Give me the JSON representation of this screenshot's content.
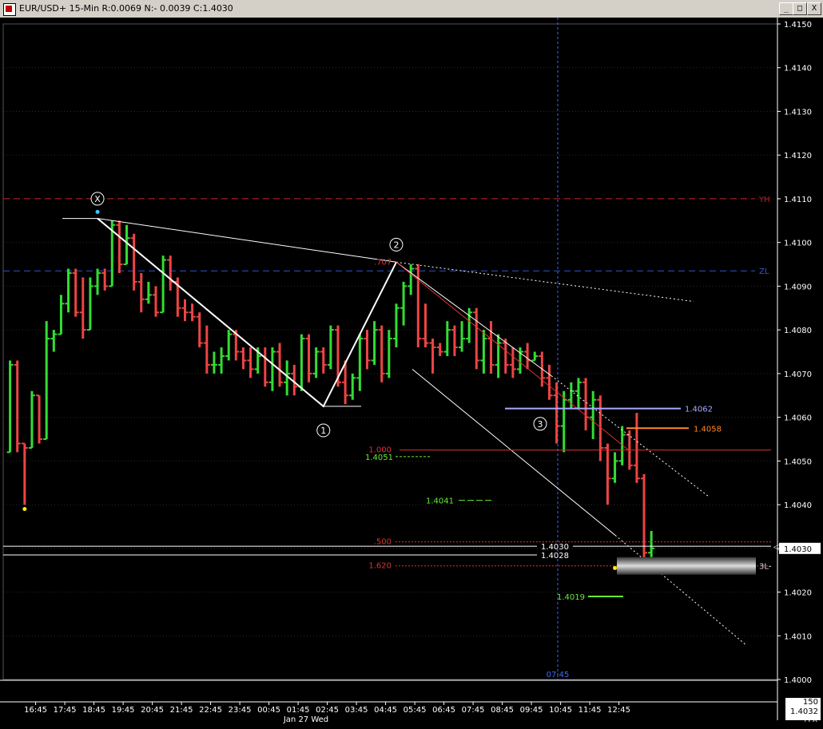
{
  "window": {
    "title": "EUR/USD+ 15-Min R:0.0069 N:- 0.0039 C:1.4030",
    "min_label": "_",
    "max_label": "□",
    "close_label": "X"
  },
  "colors": {
    "background": "#000000",
    "up_bar": "#33dd33",
    "down_bar": "#ee4444",
    "white_line": "#ffffff",
    "yh_line": "#cc2222",
    "zl_line": "#3355cc",
    "crosshair": "#4466ff",
    "fib_red": "#dd3333",
    "label_orange": "#ff8822",
    "label_lavender": "#aaaaff",
    "label_green": "#66ee33",
    "dot_yellow": "#ffee00",
    "dot_cyan": "#33ccff"
  },
  "chart_data": {
    "type": "candlestick-ohlc",
    "symbol": "EUR/USD+",
    "interval": "15-Min",
    "ylim": [
      1.4,
      1.415
    ],
    "y_ticks": [
      "1.4150",
      "1.4140",
      "1.4130",
      "1.4120",
      "1.4110",
      "1.4100",
      "1.4090",
      "1.4080",
      "1.4070",
      "1.4060",
      "1.4050",
      "1.4040",
      "1.4030",
      "1.4020",
      "1.4010",
      "1.4000"
    ],
    "x_ticks": [
      "16:45",
      "17:45",
      "18:45",
      "19:45",
      "20:45",
      "21:45",
      "22:45",
      "23:45",
      "00:45",
      "01:45",
      "02:45",
      "03:45",
      "04:45",
      "05:45",
      "06:45",
      "07:45",
      "08:45",
      "09:45",
      "10:45",
      "11:45",
      "12:45"
    ],
    "date_label": "Jan 27 Wed",
    "crosshair_time": "07:45",
    "bars": [
      {
        "o": 1.4052,
        "h": 1.4073,
        "l": 1.4052,
        "c": 1.4072
      },
      {
        "o": 1.4072,
        "h": 1.4073,
        "l": 1.4052,
        "c": 1.4054
      },
      {
        "o": 1.4054,
        "h": 1.4054,
        "l": 1.404,
        "c": 1.4053
      },
      {
        "o": 1.4053,
        "h": 1.4066,
        "l": 1.4053,
        "c": 1.4065
      },
      {
        "o": 1.4065,
        "h": 1.4065,
        "l": 1.4054,
        "c": 1.4055
      },
      {
        "o": 1.4055,
        "h": 1.4082,
        "l": 1.4055,
        "c": 1.4078
      },
      {
        "o": 1.4078,
        "h": 1.408,
        "l": 1.4075,
        "c": 1.4079
      },
      {
        "o": 1.4079,
        "h": 1.4088,
        "l": 1.4079,
        "c": 1.4086
      },
      {
        "o": 1.4086,
        "h": 1.4094,
        "l": 1.4084,
        "c": 1.4093
      },
      {
        "o": 1.4093,
        "h": 1.4094,
        "l": 1.4083,
        "c": 1.4084
      },
      {
        "o": 1.4084,
        "h": 1.4092,
        "l": 1.4078,
        "c": 1.408
      },
      {
        "o": 1.408,
        "h": 1.4092,
        "l": 1.408,
        "c": 1.409
      },
      {
        "o": 1.409,
        "h": 1.4094,
        "l": 1.4088,
        "c": 1.4093
      },
      {
        "o": 1.4093,
        "h": 1.4094,
        "l": 1.4089,
        "c": 1.409
      },
      {
        "o": 1.409,
        "h": 1.4105,
        "l": 1.409,
        "c": 1.4104
      },
      {
        "o": 1.4104,
        "h": 1.4105,
        "l": 1.4093,
        "c": 1.4095
      },
      {
        "o": 1.4095,
        "h": 1.4104,
        "l": 1.4095,
        "c": 1.4101
      },
      {
        "o": 1.4101,
        "h": 1.4102,
        "l": 1.4089,
        "c": 1.4091
      },
      {
        "o": 1.4091,
        "h": 1.4093,
        "l": 1.4084,
        "c": 1.4087
      },
      {
        "o": 1.4087,
        "h": 1.4091,
        "l": 1.4086,
        "c": 1.4088
      },
      {
        "o": 1.4088,
        "h": 1.409,
        "l": 1.4083,
        "c": 1.4084
      },
      {
        "o": 1.4084,
        "h": 1.4097,
        "l": 1.4084,
        "c": 1.4096
      },
      {
        "o": 1.4096,
        "h": 1.4097,
        "l": 1.4089,
        "c": 1.4091
      },
      {
        "o": 1.4091,
        "h": 1.4092,
        "l": 1.4083,
        "c": 1.4085
      },
      {
        "o": 1.4085,
        "h": 1.4087,
        "l": 1.4082,
        "c": 1.4084
      },
      {
        "o": 1.4084,
        "h": 1.4086,
        "l": 1.4082,
        "c": 1.4083
      },
      {
        "o": 1.4083,
        "h": 1.4084,
        "l": 1.4076,
        "c": 1.4077
      },
      {
        "o": 1.4077,
        "h": 1.4081,
        "l": 1.407,
        "c": 1.4072
      },
      {
        "o": 1.4072,
        "h": 1.4075,
        "l": 1.407,
        "c": 1.4072
      },
      {
        "o": 1.4072,
        "h": 1.4076,
        "l": 1.407,
        "c": 1.4074
      },
      {
        "o": 1.4074,
        "h": 1.408,
        "l": 1.4073,
        "c": 1.4079
      },
      {
        "o": 1.4079,
        "h": 1.408,
        "l": 1.4073,
        "c": 1.4075
      },
      {
        "o": 1.4075,
        "h": 1.4076,
        "l": 1.4071,
        "c": 1.4073
      },
      {
        "o": 1.4073,
        "h": 1.4076,
        "l": 1.4069,
        "c": 1.4071
      },
      {
        "o": 1.4071,
        "h": 1.4076,
        "l": 1.407,
        "c": 1.4074
      },
      {
        "o": 1.4074,
        "h": 1.4076,
        "l": 1.4067,
        "c": 1.4068
      },
      {
        "o": 1.4068,
        "h": 1.4076,
        "l": 1.4066,
        "c": 1.4075
      },
      {
        "o": 1.4075,
        "h": 1.4077,
        "l": 1.4067,
        "c": 1.4068
      },
      {
        "o": 1.4068,
        "h": 1.4073,
        "l": 1.4065,
        "c": 1.407
      },
      {
        "o": 1.407,
        "h": 1.4072,
        "l": 1.4065,
        "c": 1.4067
      },
      {
        "o": 1.4067,
        "h": 1.4079,
        "l": 1.4066,
        "c": 1.4078
      },
      {
        "o": 1.4078,
        "h": 1.4079,
        "l": 1.4068,
        "c": 1.407
      },
      {
        "o": 1.407,
        "h": 1.4076,
        "l": 1.4069,
        "c": 1.4075
      },
      {
        "o": 1.4075,
        "h": 1.4076,
        "l": 1.407,
        "c": 1.4072
      },
      {
        "o": 1.4072,
        "h": 1.4081,
        "l": 1.4071,
        "c": 1.408
      },
      {
        "o": 1.408,
        "h": 1.4081,
        "l": 1.4067,
        "c": 1.4068
      },
      {
        "o": 1.4068,
        "h": 1.4073,
        "l": 1.4063,
        "c": 1.4065
      },
      {
        "o": 1.4065,
        "h": 1.407,
        "l": 1.4064,
        "c": 1.4069
      },
      {
        "o": 1.4069,
        "h": 1.4079,
        "l": 1.4066,
        "c": 1.4078
      },
      {
        "o": 1.4078,
        "h": 1.408,
        "l": 1.4071,
        "c": 1.4073
      },
      {
        "o": 1.4073,
        "h": 1.4082,
        "l": 1.4072,
        "c": 1.408
      },
      {
        "o": 1.408,
        "h": 1.4081,
        "l": 1.4068,
        "c": 1.407
      },
      {
        "o": 1.407,
        "h": 1.408,
        "l": 1.4069,
        "c": 1.4078
      },
      {
        "o": 1.4078,
        "h": 1.4086,
        "l": 1.4076,
        "c": 1.4085
      },
      {
        "o": 1.4085,
        "h": 1.4091,
        "l": 1.4081,
        "c": 1.409
      },
      {
        "o": 1.409,
        "h": 1.4095,
        "l": 1.4088,
        "c": 1.4094
      },
      {
        "o": 1.4094,
        "h": 1.4095,
        "l": 1.4076,
        "c": 1.4078
      },
      {
        "o": 1.4078,
        "h": 1.4086,
        "l": 1.4076,
        "c": 1.4077
      },
      {
        "o": 1.4077,
        "h": 1.4078,
        "l": 1.407,
        "c": 1.4076
      },
      {
        "o": 1.4076,
        "h": 1.4077,
        "l": 1.4074,
        "c": 1.4075
      },
      {
        "o": 1.4075,
        "h": 1.4082,
        "l": 1.4074,
        "c": 1.408
      },
      {
        "o": 1.408,
        "h": 1.4081,
        "l": 1.4074,
        "c": 1.4076
      },
      {
        "o": 1.4076,
        "h": 1.4082,
        "l": 1.4075,
        "c": 1.4078
      },
      {
        "o": 1.4078,
        "h": 1.4085,
        "l": 1.4077,
        "c": 1.4084
      },
      {
        "o": 1.4084,
        "h": 1.4085,
        "l": 1.4071,
        "c": 1.4073
      },
      {
        "o": 1.4073,
        "h": 1.408,
        "l": 1.407,
        "c": 1.4078
      },
      {
        "o": 1.4078,
        "h": 1.4082,
        "l": 1.407,
        "c": 1.4072
      },
      {
        "o": 1.4072,
        "h": 1.4079,
        "l": 1.4069,
        "c": 1.4077
      },
      {
        "o": 1.4077,
        "h": 1.4078,
        "l": 1.407,
        "c": 1.4072
      },
      {
        "o": 1.4072,
        "h": 1.4076,
        "l": 1.4069,
        "c": 1.4071
      },
      {
        "o": 1.4071,
        "h": 1.4076,
        "l": 1.407,
        "c": 1.4075
      },
      {
        "o": 1.4075,
        "h": 1.4077,
        "l": 1.4071,
        "c": 1.4073
      },
      {
        "o": 1.4073,
        "h": 1.4075,
        "l": 1.4073,
        "c": 1.4074
      },
      {
        "o": 1.4074,
        "h": 1.4075,
        "l": 1.4067,
        "c": 1.4069
      },
      {
        "o": 1.4069,
        "h": 1.4072,
        "l": 1.4064,
        "c": 1.4065
      },
      {
        "o": 1.4065,
        "h": 1.4068,
        "l": 1.4054,
        "c": 1.4058
      },
      {
        "o": 1.4058,
        "h": 1.4066,
        "l": 1.4052,
        "c": 1.4064
      },
      {
        "o": 1.4064,
        "h": 1.4068,
        "l": 1.4062,
        "c": 1.4066
      },
      {
        "o": 1.4066,
        "h": 1.4069,
        "l": 1.4062,
        "c": 1.4068
      },
      {
        "o": 1.4068,
        "h": 1.4069,
        "l": 1.4057,
        "c": 1.406
      },
      {
        "o": 1.406,
        "h": 1.4066,
        "l": 1.4055,
        "c": 1.4064
      },
      {
        "o": 1.4064,
        "h": 1.4065,
        "l": 1.405,
        "c": 1.4053
      },
      {
        "o": 1.4053,
        "h": 1.4054,
        "l": 1.404,
        "c": 1.4046
      },
      {
        "o": 1.4046,
        "h": 1.4052,
        "l": 1.4045,
        "c": 1.405
      },
      {
        "o": 1.405,
        "h": 1.4058,
        "l": 1.4049,
        "c": 1.4056
      },
      {
        "o": 1.4056,
        "h": 1.4057,
        "l": 1.4048,
        "c": 1.4049
      },
      {
        "o": 1.4049,
        "h": 1.4061,
        "l": 1.4045,
        "c": 1.4046
      },
      {
        "o": 1.4046,
        "h": 1.4047,
        "l": 1.4026,
        "c": 1.4029
      },
      {
        "o": 1.4029,
        "h": 1.4034,
        "l": 1.4028,
        "c": 1.403
      }
    ]
  },
  "price_axis": {
    "current_price": "1.4030",
    "yh_label": "YH",
    "zl_label": "ZL",
    "sl_label": "3L-",
    "fx_label": "+FX"
  },
  "annotations": {
    "fib_1000": "1.000",
    "fib_0500": ".500",
    "fib_1620": "1.620",
    "fib_0707": ".707",
    "lvl_4062": "1.4062",
    "lvl_4058": "1.4058",
    "lvl_4051": "1.4051",
    "lvl_4041": "1.4041",
    "lvl_4030": "1.4030",
    "lvl_4028": "1.4028",
    "lvl_4019": "1.4019",
    "wave_x": "X",
    "wave_1": "1",
    "wave_2": "2",
    "wave_3": "3"
  },
  "volume": {
    "value": "150",
    "price": "1.4032"
  }
}
